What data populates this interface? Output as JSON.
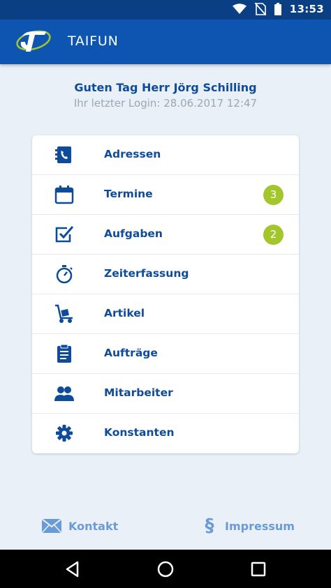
{
  "status_bar": {
    "time": "13:53",
    "icons": [
      "wifi-icon",
      "no-sim-icon",
      "battery-icon"
    ]
  },
  "app_bar": {
    "title": "TAIFUN",
    "logo": "taifun-logo"
  },
  "greeting": {
    "hello": "Guten Tag Herr Jörg Schilling",
    "last_login": "Ihr letzter Login: 28.06.2017  12:47"
  },
  "menu": {
    "items": [
      {
        "label": "Adressen",
        "icon": "address-book-icon"
      },
      {
        "label": "Termine",
        "icon": "calendar-icon",
        "badge": "3"
      },
      {
        "label": "Aufgaben",
        "icon": "checkbox-icon",
        "badge": "2"
      },
      {
        "label": "Zeiterfassung",
        "icon": "stopwatch-icon"
      },
      {
        "label": "Artikel",
        "icon": "hand-truck-icon"
      },
      {
        "label": "Aufträge",
        "icon": "clipboard-icon"
      },
      {
        "label": "Mitarbeiter",
        "icon": "people-icon"
      },
      {
        "label": "Konstanten",
        "icon": "gear-icon"
      }
    ]
  },
  "footer": {
    "contact_label": "Kontakt",
    "imprint_label": "Impressum",
    "imprint_symbol": "§"
  },
  "colors": {
    "status_bar": "#0a3f84",
    "app_bar": "#0d55b0",
    "text_primary": "#0e4c9a",
    "badge": "#a3c62d",
    "footer_link": "#6b9bd6",
    "background": "#e9f0f7"
  }
}
